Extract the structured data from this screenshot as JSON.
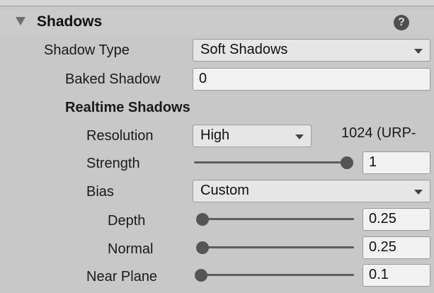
{
  "header": {
    "title": "Shadows",
    "help_glyph": "?"
  },
  "shadow_type": {
    "label": "Shadow Type",
    "value": "Soft Shadows"
  },
  "baked_shadow": {
    "label": "Baked Shadow",
    "value": "0"
  },
  "realtime": {
    "heading": "Realtime Shadows"
  },
  "resolution": {
    "label": "Resolution",
    "value": "High",
    "note": "1024 (URP-"
  },
  "strength": {
    "label": "Strength",
    "value": "1",
    "level": 1.0
  },
  "bias": {
    "label": "Bias",
    "value": "Custom"
  },
  "depth": {
    "label": "Depth",
    "value": "0.25",
    "level": 0.0
  },
  "normal": {
    "label": "Normal",
    "value": "0.25",
    "level": 0.0
  },
  "near_plane": {
    "label": "Near Plane",
    "value": "0.1",
    "level": 0.0
  },
  "colors": {
    "panel": "#c8c8c8",
    "field": "#f2f2f2",
    "dropdown": "#e6e6e6",
    "thumb": "#555555"
  }
}
